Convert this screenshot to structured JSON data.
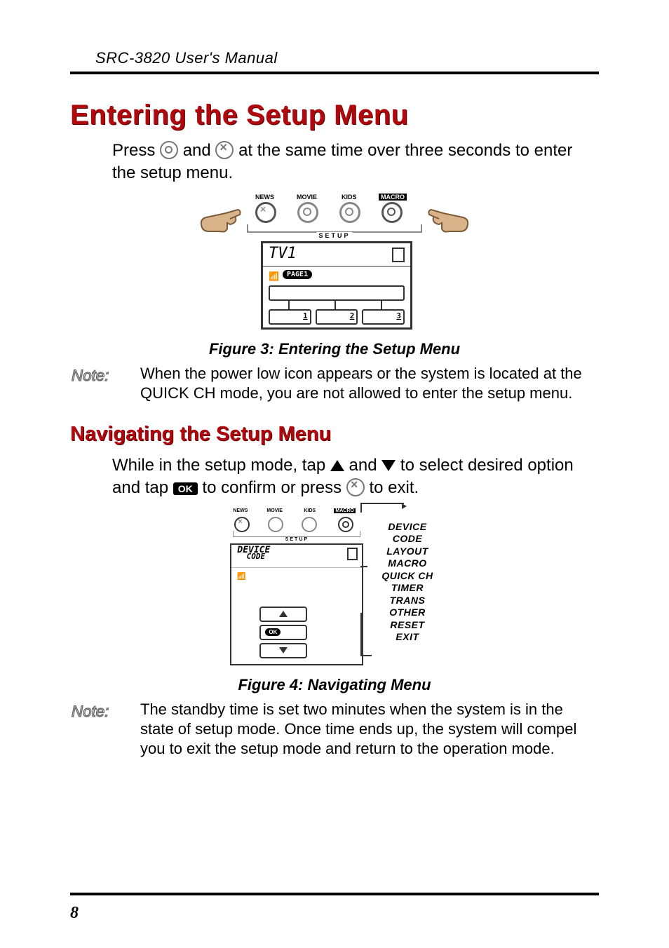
{
  "header": {
    "running": "SRC-3820 User's Manual"
  },
  "h1": "Entering the Setup Menu",
  "p1a": "Press ",
  "p1b": " and ",
  "p1c": " at the same time over three seconds to enter the setup menu.",
  "fig3": {
    "btn_labels": [
      "NEWS",
      "MOVIE",
      "KIDS",
      "MACRO"
    ],
    "setup": "SETUP",
    "tv": "TV1",
    "page": "PAGE1",
    "sk": [
      "1",
      "2",
      "3"
    ]
  },
  "cap3": "Figure 3: Entering the Setup Menu",
  "note1": "When the power low icon appears or the system is located at the QUICK CH mode, you are not allowed to enter the setup menu.",
  "h2": "Navigating the Setup Menu",
  "p2a": "While in the setup mode, tap ",
  "p2b": " and ",
  "p2c": " to select desired option and tap ",
  "p2d": " to confirm or press ",
  "p2e": " to exit.",
  "fig4": {
    "btn_labels": [
      "NEWS",
      "MOVIE",
      "KIDS",
      "MACRO"
    ],
    "setup": "SETUP",
    "hd1": "DEVICE",
    "hd2": "CODE",
    "ok": "OK",
    "menu": [
      "DEVICE",
      "CODE",
      "LAYOUT",
      "MACRO",
      "QUICK CH",
      "TIMER",
      "TRANS",
      "OTHER",
      "RESET",
      "EXIT"
    ]
  },
  "cap4": "Figure 4: Navigating Menu",
  "note2": "The standby time is set two minutes when the system is in the state of setup mode.  Once time ends up, the system will compel you to exit the setup mode and return to the operation mode.",
  "note_word": "Note:",
  "pagenum": "8"
}
